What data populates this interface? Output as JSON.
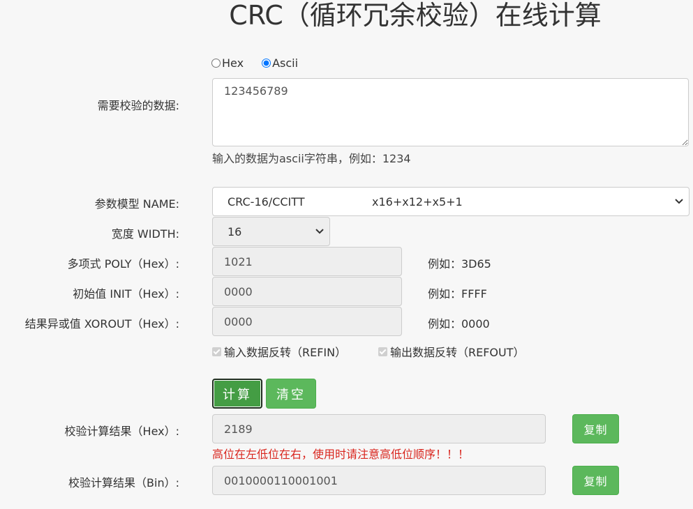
{
  "title": "CRC（循环冗余校验）在线计算",
  "format": {
    "options": [
      {
        "label": "Hex",
        "checked": false
      },
      {
        "label": "Ascii",
        "checked": true
      }
    ]
  },
  "data_input": {
    "label": "需要校验的数据:",
    "value": "123456789",
    "help": "输入的数据为ascii字符串，例如：1234"
  },
  "model": {
    "label": "参数模型 NAME:",
    "selected_name": "CRC-16/CCITT",
    "selected_poly": "x16+x12+x5+1"
  },
  "width": {
    "label": "宽度 WIDTH:",
    "selected": "16"
  },
  "poly": {
    "label": "多项式 POLY（Hex）:",
    "value": "1021",
    "example": "例如：3D65"
  },
  "init": {
    "label": "初始值 INIT（Hex）:",
    "value": "0000",
    "example": "例如：FFFF"
  },
  "xorout": {
    "label": "结果异或值 XOROUT（Hex）:",
    "value": "0000",
    "example": "例如：0000"
  },
  "refin": {
    "label": "输入数据反转（REFIN）",
    "checked": true
  },
  "refout": {
    "label": "输出数据反转（REFOUT）",
    "checked": true
  },
  "buttons": {
    "calculate": "计算",
    "clear": "清空",
    "copy": "复制"
  },
  "result_hex": {
    "label": "校验计算结果（Hex）:",
    "value": "2189",
    "warning": "高位在左低位在右，使用时请注意高低位顺序！！！"
  },
  "result_bin": {
    "label": "校验计算结果（Bin）:",
    "value": "0010000110001001"
  },
  "colors": {
    "button_green": "#5cb85c",
    "warning_red": "#d9251d"
  }
}
